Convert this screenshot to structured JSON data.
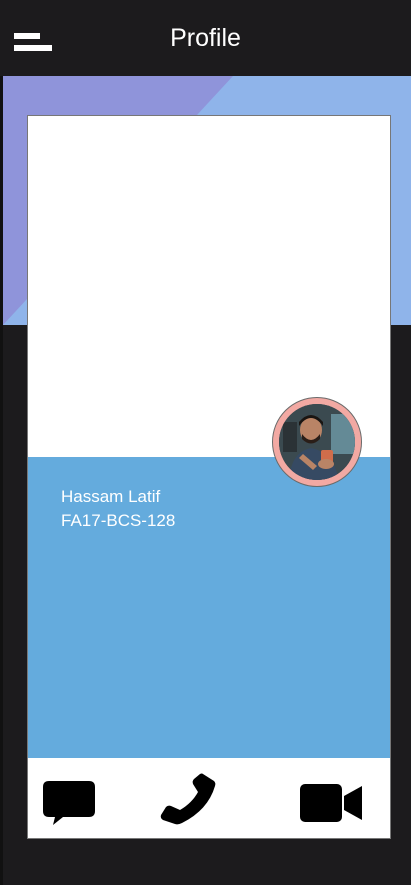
{
  "app_bar": {
    "title": "Profile",
    "menu_icon": "hamburger-menu-icon"
  },
  "profile": {
    "name": "Hassam Latif",
    "registration": "FA17-BCS-128",
    "avatar": "profile-photo"
  },
  "actions": [
    {
      "icon": "message-icon"
    },
    {
      "icon": "phone-icon"
    },
    {
      "icon": "video-camera-icon"
    }
  ],
  "colors": {
    "app_bar": "#1c1b1d",
    "banner": "#8fb4ea",
    "banner_accent": "#8f94da",
    "info_panel": "#64abdd",
    "avatar_ring": "#f2a9a3"
  }
}
